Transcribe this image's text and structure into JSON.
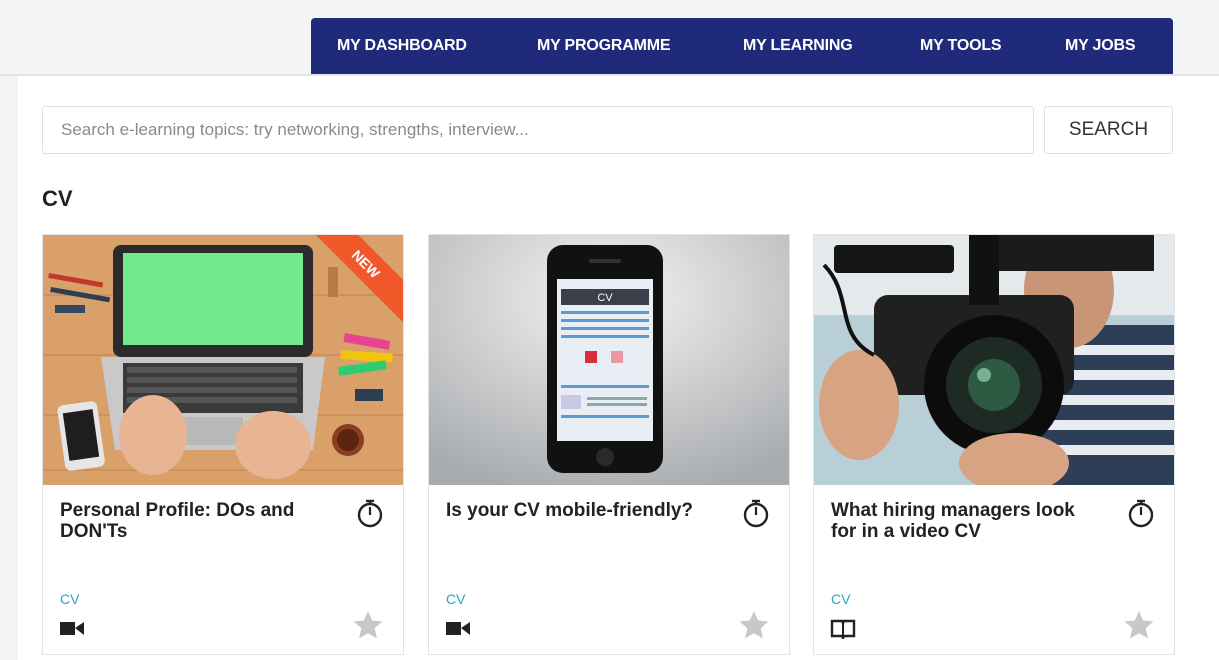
{
  "nav": {
    "items": [
      {
        "label": "MY DASHBOARD"
      },
      {
        "label": "MY PROGRAMME"
      },
      {
        "label": "MY LEARNING"
      },
      {
        "label": "MY TOOLS"
      },
      {
        "label": "MY JOBS"
      }
    ]
  },
  "search": {
    "placeholder": "Search e-learning topics: try networking, strengths, interview...",
    "value": "",
    "button_label": "SEARCH"
  },
  "section": {
    "title": "CV"
  },
  "cards": [
    {
      "title": "Personal Profile: DOs and DON'Ts",
      "category": "CV",
      "badge": "NEW",
      "type_icon": "video-camera-icon",
      "image": "laptop-desk-photo",
      "favorited": false
    },
    {
      "title": "Is your CV mobile-friendly?",
      "category": "CV",
      "image_text": "CV",
      "type_icon": "video-camera-icon",
      "image": "smartphone-cv-photo",
      "favorited": false
    },
    {
      "title": "What hiring managers look for in a video CV",
      "category": "CV",
      "type_icon": "book-icon",
      "image": "video-camera-operator-photo",
      "favorited": false
    }
  ],
  "colors": {
    "nav_bg": "#1f2a7a",
    "category_text": "#2aa3c6",
    "badge_bg": "#f0582a",
    "star_inactive": "#c8c8c8"
  }
}
